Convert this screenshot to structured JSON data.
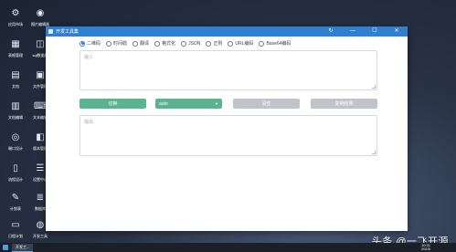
{
  "desktop": {
    "icons": [
      {
        "icon": "gear-icon",
        "glyph": "⚙",
        "label": "应用市场"
      },
      {
        "icon": "camera-icon",
        "glyph": "◉",
        "label": "图片编辑器"
      },
      {
        "icon": "grid-icon",
        "glyph": "▦",
        "label": "表格管理"
      },
      {
        "icon": "database-icon",
        "glyph": "◫",
        "label": "sql数据库"
      },
      {
        "icon": "document-icon",
        "glyph": "▤",
        "label": "文档"
      },
      {
        "icon": "terminal-icon",
        "glyph": "▣",
        "label": "文件管理"
      },
      {
        "icon": "chart-icon",
        "glyph": "▥",
        "label": "文档编辑"
      },
      {
        "icon": "code-icon",
        "glyph": "⌨",
        "label": "文本编辑"
      },
      {
        "icon": "monitor-icon",
        "glyph": "◎",
        "label": "端口设计"
      },
      {
        "icon": "box-icon",
        "glyph": "◧",
        "label": "版本管理"
      },
      {
        "icon": "page-icon",
        "glyph": "▯",
        "label": "流程设计"
      },
      {
        "icon": "sliders-icon",
        "glyph": "☰",
        "label": "设置中心"
      },
      {
        "icon": "tool-icon",
        "glyph": "✎",
        "label": "计划表"
      },
      {
        "icon": "stack-icon",
        "glyph": "≣",
        "label": "数据库"
      },
      {
        "icon": "clipboard-icon",
        "glyph": "▭",
        "label": "日程计划"
      },
      {
        "icon": "globe-icon",
        "glyph": "◍",
        "label": "开发工具"
      }
    ]
  },
  "window": {
    "title": "开发工具集",
    "controls": {
      "refresh": "↻",
      "minimize": "—",
      "maximize": "☐",
      "close": "✕"
    },
    "tabs": [
      {
        "label": "二维码",
        "checked": true
      },
      {
        "label": "时间戳",
        "checked": false
      },
      {
        "label": "翻译",
        "checked": false
      },
      {
        "label": "格式化",
        "checked": false
      },
      {
        "label": "JSON",
        "checked": false
      },
      {
        "label": "正则",
        "checked": false
      },
      {
        "label": "URL编码",
        "checked": false
      },
      {
        "label": "Base64编码",
        "checked": false
      }
    ],
    "input_placeholder": "输入",
    "output_placeholder": "输出",
    "convert_label": "切换",
    "select_value": "auto",
    "clear_label": "清空",
    "copy_label": "复制结果"
  },
  "taskbar": {
    "app_label": "开发工...",
    "time": "10:31",
    "date": "2023/"
  },
  "watermark": "头条 @一飞开源",
  "colors": {
    "titlebar": "#2f80d1",
    "primary_button": "#5bb48f",
    "disabled_button": "#c0c4ca"
  }
}
